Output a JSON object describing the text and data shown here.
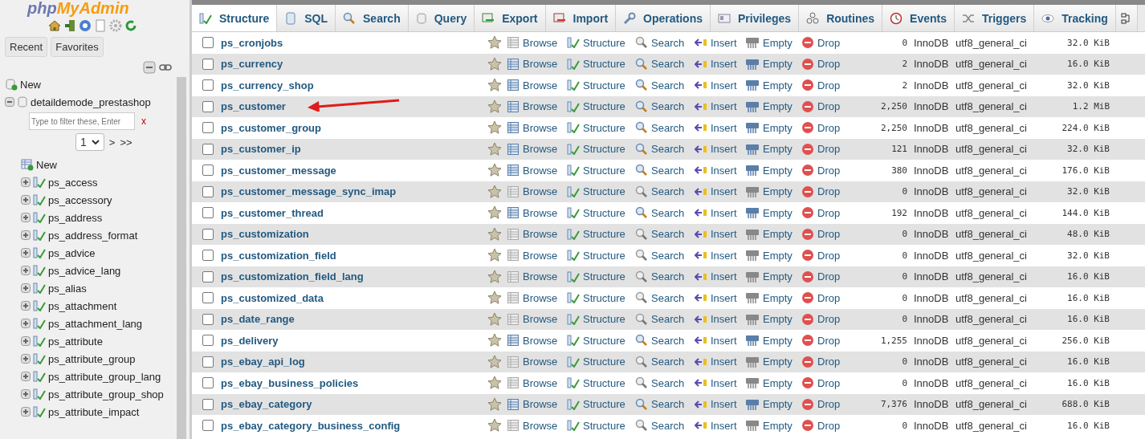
{
  "sidebar": {
    "logo": [
      "php",
      "MyAdmin"
    ],
    "tabs": [
      {
        "label": "Recent",
        "selected": false
      },
      {
        "label": "Favorites",
        "selected": false
      }
    ],
    "tree": [
      {
        "label": "New",
        "kind": "new"
      },
      {
        "label": "detaildemode_prestashop",
        "kind": "database",
        "expanded": true,
        "filter": {
          "placeholder": "Type to filter these, Enter",
          "clear": "x"
        },
        "pager": {
          "value": "1",
          "next": ">",
          "last": ">>"
        },
        "children": [
          {
            "label": "New",
            "kind": "new"
          },
          {
            "label": "ps_access",
            "kind": "table",
            "expanded": false
          },
          {
            "label": "ps_accessory",
            "kind": "table",
            "expanded": false
          },
          {
            "label": "ps_address",
            "kind": "table",
            "expanded": false
          },
          {
            "label": "ps_address_format",
            "kind": "table",
            "expanded": false
          },
          {
            "label": "ps_advice",
            "kind": "table",
            "expanded": false
          },
          {
            "label": "ps_advice_lang",
            "kind": "table",
            "expanded": false
          },
          {
            "label": "ps_alias",
            "kind": "table",
            "expanded": false
          },
          {
            "label": "ps_attachment",
            "kind": "table",
            "expanded": false
          },
          {
            "label": "ps_attachment_lang",
            "kind": "table",
            "expanded": false
          },
          {
            "label": "ps_attribute",
            "kind": "table",
            "expanded": false
          },
          {
            "label": "ps_attribute_group",
            "kind": "table",
            "expanded": false
          },
          {
            "label": "ps_attribute_group_lang",
            "kind": "table",
            "expanded": false
          },
          {
            "label": "ps_attribute_group_shop",
            "kind": "table",
            "expanded": false
          },
          {
            "label": "ps_attribute_impact",
            "kind": "table",
            "expanded": false
          }
        ]
      }
    ]
  },
  "tabs": [
    {
      "label": "Structure",
      "kind": "structure",
      "selected": true
    },
    {
      "label": "SQL",
      "kind": "sql",
      "selected": false
    },
    {
      "label": "Search",
      "kind": "search",
      "selected": false
    },
    {
      "label": "Query",
      "kind": "query",
      "selected": false
    },
    {
      "label": "Export",
      "kind": "export",
      "selected": false
    },
    {
      "label": "Import",
      "kind": "import",
      "selected": false
    },
    {
      "label": "Operations",
      "kind": "operations",
      "selected": false
    },
    {
      "label": "Privileges",
      "kind": "privileges",
      "selected": false
    },
    {
      "label": "Routines",
      "kind": "routines",
      "selected": false
    },
    {
      "label": "Events",
      "kind": "events",
      "selected": false
    },
    {
      "label": "Triggers",
      "kind": "triggers",
      "selected": false
    },
    {
      "label": "Tracking",
      "kind": "tracking",
      "selected": false
    }
  ],
  "table": {
    "rows": [
      {
        "checked": false,
        "name": "ps_cronjobs",
        "has_data": false,
        "actions": [
          "Browse",
          "Structure",
          "Search",
          "Insert",
          "Empty",
          "Drop"
        ],
        "rows": "0",
        "engine": "InnoDB",
        "collation": "utf8_general_ci",
        "size": "32.0 KiB"
      },
      {
        "checked": false,
        "name": "ps_currency",
        "has_data": true,
        "actions": [
          "Browse",
          "Structure",
          "Search",
          "Insert",
          "Empty",
          "Drop"
        ],
        "rows": "2",
        "engine": "InnoDB",
        "collation": "utf8_general_ci",
        "size": "16.0 KiB"
      },
      {
        "checked": false,
        "name": "ps_currency_shop",
        "has_data": true,
        "actions": [
          "Browse",
          "Structure",
          "Search",
          "Insert",
          "Empty",
          "Drop"
        ],
        "rows": "2",
        "engine": "InnoDB",
        "collation": "utf8_general_ci",
        "size": "32.0 KiB"
      },
      {
        "checked": false,
        "name": "ps_customer",
        "has_data": true,
        "annotated": true,
        "actions": [
          "Browse",
          "Structure",
          "Search",
          "Insert",
          "Empty",
          "Drop"
        ],
        "rows": "2,250",
        "engine": "InnoDB",
        "collation": "utf8_general_ci",
        "size": "1.2 MiB"
      },
      {
        "checked": false,
        "name": "ps_customer_group",
        "has_data": true,
        "actions": [
          "Browse",
          "Structure",
          "Search",
          "Insert",
          "Empty",
          "Drop"
        ],
        "rows": "2,250",
        "engine": "InnoDB",
        "collation": "utf8_general_ci",
        "size": "224.0 KiB"
      },
      {
        "checked": false,
        "name": "ps_customer_ip",
        "has_data": true,
        "actions": [
          "Browse",
          "Structure",
          "Search",
          "Insert",
          "Empty",
          "Drop"
        ],
        "rows": "121",
        "engine": "InnoDB",
        "collation": "utf8_general_ci",
        "size": "32.0 KiB"
      },
      {
        "checked": false,
        "name": "ps_customer_message",
        "has_data": true,
        "actions": [
          "Browse",
          "Structure",
          "Search",
          "Insert",
          "Empty",
          "Drop"
        ],
        "rows": "380",
        "engine": "InnoDB",
        "collation": "utf8_general_ci",
        "size": "176.0 KiB"
      },
      {
        "checked": false,
        "name": "ps_customer_message_sync_imap",
        "has_data": false,
        "actions": [
          "Browse",
          "Structure",
          "Search",
          "Insert",
          "Empty",
          "Drop"
        ],
        "rows": "0",
        "engine": "InnoDB",
        "collation": "utf8_general_ci",
        "size": "32.0 KiB"
      },
      {
        "checked": false,
        "name": "ps_customer_thread",
        "has_data": true,
        "actions": [
          "Browse",
          "Structure",
          "Search",
          "Insert",
          "Empty",
          "Drop"
        ],
        "rows": "192",
        "engine": "InnoDB",
        "collation": "utf8_general_ci",
        "size": "144.0 KiB"
      },
      {
        "checked": false,
        "name": "ps_customization",
        "has_data": false,
        "actions": [
          "Browse",
          "Structure",
          "Search",
          "Insert",
          "Empty",
          "Drop"
        ],
        "rows": "0",
        "engine": "InnoDB",
        "collation": "utf8_general_ci",
        "size": "48.0 KiB"
      },
      {
        "checked": false,
        "name": "ps_customization_field",
        "has_data": false,
        "actions": [
          "Browse",
          "Structure",
          "Search",
          "Insert",
          "Empty",
          "Drop"
        ],
        "rows": "0",
        "engine": "InnoDB",
        "collation": "utf8_general_ci",
        "size": "32.0 KiB"
      },
      {
        "checked": false,
        "name": "ps_customization_field_lang",
        "has_data": false,
        "actions": [
          "Browse",
          "Structure",
          "Search",
          "Insert",
          "Empty",
          "Drop"
        ],
        "rows": "0",
        "engine": "InnoDB",
        "collation": "utf8_general_ci",
        "size": "16.0 KiB"
      },
      {
        "checked": false,
        "name": "ps_customized_data",
        "has_data": false,
        "actions": [
          "Browse",
          "Structure",
          "Search",
          "Insert",
          "Empty",
          "Drop"
        ],
        "rows": "0",
        "engine": "InnoDB",
        "collation": "utf8_general_ci",
        "size": "16.0 KiB"
      },
      {
        "checked": false,
        "name": "ps_date_range",
        "has_data": false,
        "actions": [
          "Browse",
          "Structure",
          "Search",
          "Insert",
          "Empty",
          "Drop"
        ],
        "rows": "0",
        "engine": "InnoDB",
        "collation": "utf8_general_ci",
        "size": "16.0 KiB"
      },
      {
        "checked": false,
        "name": "ps_delivery",
        "has_data": true,
        "actions": [
          "Browse",
          "Structure",
          "Search",
          "Insert",
          "Empty",
          "Drop"
        ],
        "rows": "1,255",
        "engine": "InnoDB",
        "collation": "utf8_general_ci",
        "size": "256.0 KiB"
      },
      {
        "checked": false,
        "name": "ps_ebay_api_log",
        "has_data": false,
        "actions": [
          "Browse",
          "Structure",
          "Search",
          "Insert",
          "Empty",
          "Drop"
        ],
        "rows": "0",
        "engine": "InnoDB",
        "collation": "utf8_general_ci",
        "size": "16.0 KiB"
      },
      {
        "checked": false,
        "name": "ps_ebay_business_policies",
        "has_data": false,
        "actions": [
          "Browse",
          "Structure",
          "Search",
          "Insert",
          "Empty",
          "Drop"
        ],
        "rows": "0",
        "engine": "InnoDB",
        "collation": "utf8_general_ci",
        "size": "16.0 KiB"
      },
      {
        "checked": false,
        "name": "ps_ebay_category",
        "has_data": true,
        "actions": [
          "Browse",
          "Structure",
          "Search",
          "Insert",
          "Empty",
          "Drop"
        ],
        "rows": "7,376",
        "engine": "InnoDB",
        "collation": "utf8_general_ci",
        "size": "688.0 KiB"
      },
      {
        "checked": false,
        "name": "ps_ebay_category_business_config",
        "has_data": false,
        "actions": [
          "Browse",
          "Structure",
          "Search",
          "Insert",
          "Empty",
          "Drop"
        ],
        "rows": "0",
        "engine": "InnoDB",
        "collation": "utf8_general_ci",
        "size": "16.0 KiB"
      }
    ]
  }
}
